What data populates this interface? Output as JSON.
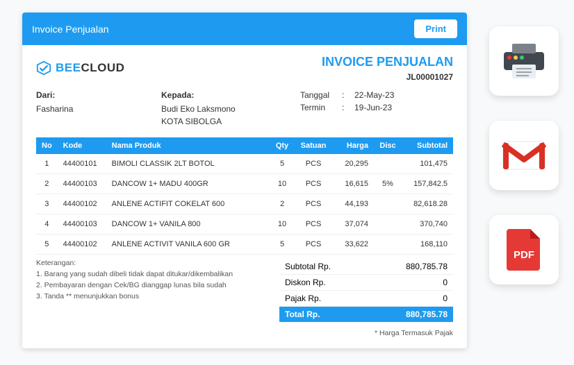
{
  "header": {
    "title": "Invoice Penjualan",
    "print_label": "Print"
  },
  "brand": {
    "part1": "BEE",
    "part2": "CLOUD"
  },
  "document": {
    "title": "INVOICE PENJUALAN",
    "number": "JL00001027"
  },
  "from": {
    "label": "Dari:",
    "name": "Fasharina"
  },
  "to": {
    "label": "Kepada:",
    "name": "Budi Eko Laksmono",
    "city": "KOTA SIBOLGA"
  },
  "dates": {
    "tanggal_label": "Tanggal",
    "tanggal_value": "22-May-23",
    "termin_label": "Termin",
    "termin_value": "19-Jun-23"
  },
  "columns": {
    "no": "No",
    "kode": "Kode",
    "nama": "Nama Produk",
    "qty": "Qty",
    "satuan": "Satuan",
    "harga": "Harga",
    "disc": "Disc",
    "subtotal": "Subtotal"
  },
  "rows": [
    {
      "no": "1",
      "kode": "44400101",
      "nama": "BIMOLI CLASSIK 2LT BOTOL",
      "qty": "5",
      "satuan": "PCS",
      "harga": "20,295",
      "disc": "",
      "subtotal": "101,475"
    },
    {
      "no": "2",
      "kode": "44400103",
      "nama": "DANCOW 1+ MADU 400GR",
      "qty": "10",
      "satuan": "PCS",
      "harga": "16,615",
      "disc": "5%",
      "subtotal": "157,842.5"
    },
    {
      "no": "3",
      "kode": "44400102",
      "nama": "ANLENE ACTIFIT COKELAT 600",
      "qty": "2",
      "satuan": "PCS",
      "harga": "44,193",
      "disc": "",
      "subtotal": "82,618.28"
    },
    {
      "no": "4",
      "kode": "44400103",
      "nama": "DANCOW 1+ VANILA 800",
      "qty": "10",
      "satuan": "PCS",
      "harga": "37,074",
      "disc": "",
      "subtotal": "370,740"
    },
    {
      "no": "5",
      "kode": "44400102",
      "nama": "ANLENE ACTIVIT VANILA 600 GR",
      "qty": "5",
      "satuan": "PCS",
      "harga": "33,622",
      "disc": "",
      "subtotal": "168,110"
    }
  ],
  "notes": {
    "heading": "Keterangan:",
    "n1": "1. Barang yang sudah dibeli tidak dapat ditukar/dikembalikan",
    "n2": "2. Pembayaran dengan Cek/BG dianggap lunas bila sudah",
    "n3": "3. Tanda ** menunjukkan bonus"
  },
  "totals": {
    "subtotal_label": "Subtotal Rp.",
    "subtotal_value": "880,785.78",
    "diskon_label": "Diskon Rp.",
    "diskon_value": "0",
    "pajak_label": "Pajak Rp.",
    "pajak_value": "0",
    "total_label": "Total Rp.",
    "total_value": "880,785.78"
  },
  "footnote": "* Harga Termasuk Pajak",
  "pdf_label": "PDF"
}
